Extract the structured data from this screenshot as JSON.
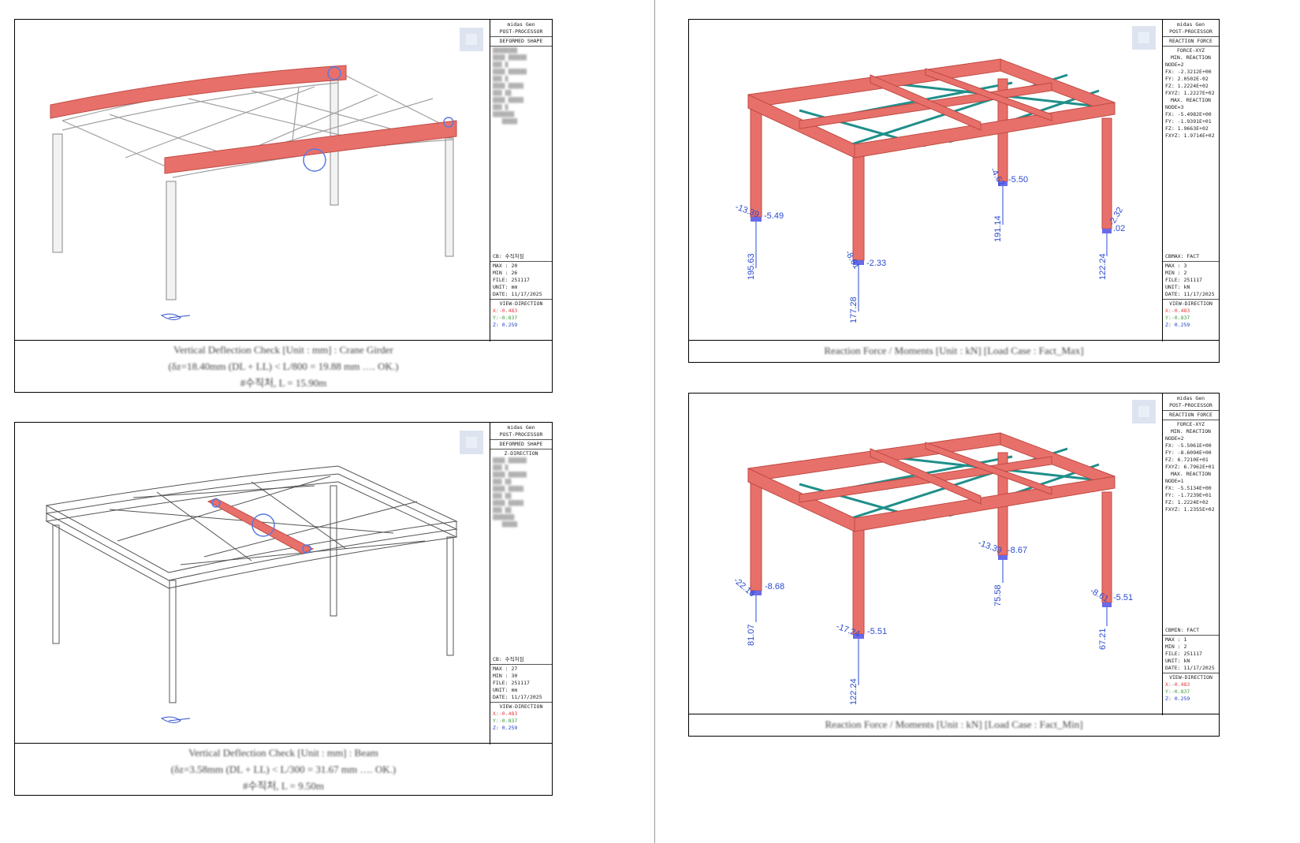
{
  "panels": {
    "tl": {
      "info": {
        "program": "midas Gen",
        "module": "POST-PROCESSOR",
        "result": "DEFORMED SHAPE",
        "cs": "CB: 수직처짐",
        "max": "MAX : 20",
        "min": "MIN : 26",
        "file": "FILE: 251117",
        "unit": "UNIT: mm",
        "date": "DATE: 11/17/2025",
        "view": "VIEW-DIRECTION",
        "vx": "X:-0.483",
        "vy": "Y:-0.837",
        "vz": "Z: 0.259"
      },
      "caption": [
        "Vertical Deflection Check [Unit : mm] : Crane Girder",
        "(δz=18.40mm (DL + LL) < L/800 = 19.88 mm …. OK.)",
        "#수직처, L = 15.90m"
      ]
    },
    "bl": {
      "info": {
        "program": "midas Gen",
        "module": "POST-PROCESSOR",
        "result": "DEFORMED SHAPE",
        "subresult": "Z-DIRECTION",
        "cs": "CB: 수직처짐",
        "max": "MAX : 27",
        "min": "MIN : 30",
        "file": "FILE: 251117",
        "unit": "UNIT: mm",
        "date": "DATE: 11/17/2025",
        "view": "VIEW-DIRECTION",
        "vx": "X:-0.483",
        "vy": "Y:-0.837",
        "vz": "Z: 0.259"
      },
      "caption": [
        "Vertical Deflection Check [Unit : mm] : Beam",
        "(δz=3.58mm (DL + LL) < L/300 = 31.67 mm …. OK.)",
        "#수직처, L = 9.50m"
      ]
    },
    "tr": {
      "info": {
        "program": "midas Gen",
        "module": "POST-PROCESSOR",
        "result": "REACTION FORCE",
        "subresult": "FORCE-XYZ",
        "min_title": "MIN. REACTION",
        "min_node": "NODE=2",
        "min_fx": "FX:  -2.3212E+00",
        "min_fy": "FY:   2.0502E-02",
        "min_fz": "FZ:   1.2224E+02",
        "min_fxyz": "FXYZ: 1.2227E+02",
        "max_title": "MAX. REACTION",
        "max_node": "NODE=3",
        "max_fx": "FX:  -5.4982E+00",
        "max_fy": "FY:  -1.9391E+01",
        "max_fz": "FZ:   1.9663E+02",
        "max_fxyz": "FXYZ: 1.9714E+02",
        "cs": "CBMAX: FACT",
        "max": "MAX : 3",
        "min": "MIN : 2",
        "file": "FILE: 251117",
        "unit": "UNIT: kN",
        "date": "DATE: 11/17/2025",
        "view": "VIEW-DIRECTION",
        "vx": "X:-0.483",
        "vy": "Y:-0.837",
        "vz": "Z: 0.259"
      },
      "labels": {
        "a1": "-13.39",
        "a2": "-5.49",
        "a3": "195.63",
        "b1": "-8.61",
        "b2": "-2.33",
        "b3": "177.28",
        "c1": "-4.62",
        "c2": "-5.50",
        "c3": "191.14",
        "d1": "-2.32",
        "d2": ".02",
        "d3": "122.24"
      },
      "caption": [
        "Reaction Force / Moments [Unit : kN] [Load Case : Fact_Max]"
      ]
    },
    "br": {
      "info": {
        "program": "midas Gen",
        "module": "POST-PROCESSOR",
        "result": "REACTION FORCE",
        "subresult": "FORCE-XYZ",
        "min_title": "MIN. REACTION",
        "min_node": "NODE=2",
        "min_fx": "FX:  -5.5061E+00",
        "min_fy": "FY:  -8.6094E+00",
        "min_fz": "FZ:   6.7210E+01",
        "min_fxyz": "FXYZ: 6.7962E+01",
        "max_title": "MAX. REACTION",
        "max_node": "NODE=1",
        "max_fx": "FX:  -5.5134E+00",
        "max_fy": "FY:  -1.7239E+01",
        "max_fz": "FZ:   1.2224E+02",
        "max_fxyz": "FXYZ: 1.2355E+02",
        "cs": "CBMIN: FACT",
        "max": "MAX : 1",
        "min": "MIN : 2",
        "file": "FILE: 251117",
        "unit": "UNIT: kN",
        "date": "DATE: 11/17/2025",
        "view": "VIEW-DIRECTION",
        "vx": "X:-0.483",
        "vy": "Y:-0.837",
        "vz": "Z: 0.259"
      },
      "labels": {
        "a1": "-22.16",
        "a2": "-8.68",
        "a3": "81.07",
        "b1": "-17.24",
        "b2": "-5.51",
        "b3": "122.24",
        "c1": "-13.39",
        "c2": "-8.67",
        "c3": "75.58",
        "d1": "-8.61",
        "d2": "-5.51",
        "d3": "67.21"
      },
      "caption": [
        "Reaction Force / Moments [Unit : kN] [Load Case : Fact_Min]"
      ]
    }
  },
  "colors": {
    "member": "#e8706a",
    "member_edge": "#c04a44",
    "brace": "#1f8f8a",
    "label": "#2a4bd0",
    "support": "#6a6ae8",
    "frame_line": "#9a9a9a"
  }
}
